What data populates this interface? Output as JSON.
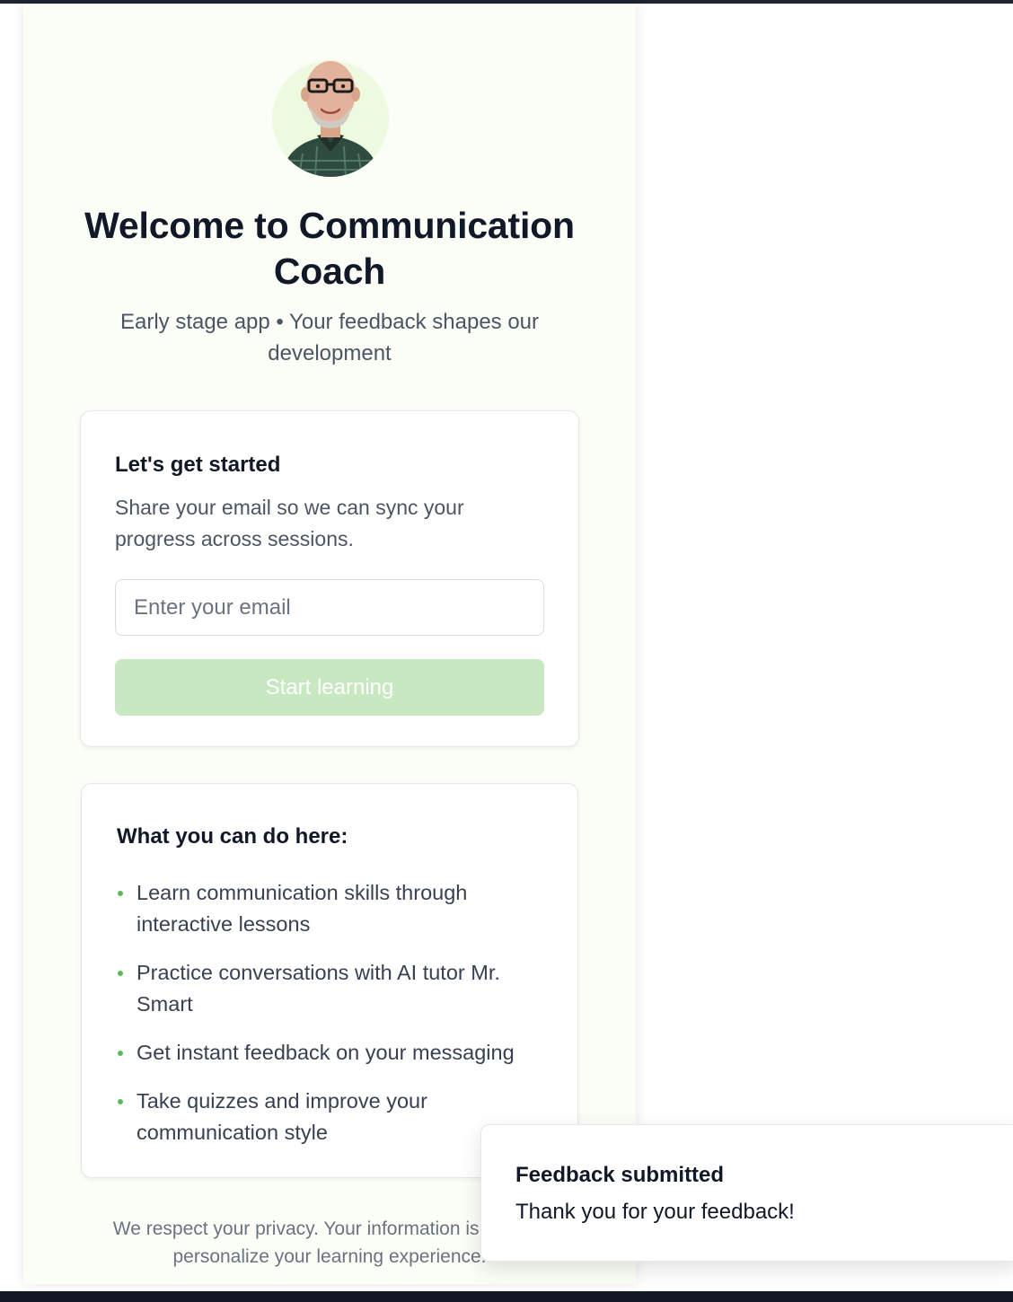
{
  "header": {
    "avatar_alt": "Mr. Smart avatar",
    "title": "Welcome to Communication Coach",
    "subtitle": "Early stage app • Your feedback shapes our development"
  },
  "signup_card": {
    "heading": "Let's get started",
    "description": "Share your email so we can sync your progress across sessions.",
    "email_placeholder": "Enter your email",
    "email_value": "",
    "start_button_label": "Start learning",
    "start_button_color": "#c7e8c0"
  },
  "features_card": {
    "heading": "What you can do here:",
    "items": [
      {
        "label": "Learn communication skills through interactive lessons"
      },
      {
        "label": "Practice conversations with AI tutor Mr. Smart"
      },
      {
        "label": "Get instant feedback on your messaging"
      },
      {
        "label": "Take quizzes and improve your communication style"
      }
    ],
    "bullet_color": "#5cb85c"
  },
  "privacy_note": "We respect your privacy. Your information is used to personalize your learning experience.",
  "toast": {
    "title": "Feedback submitted",
    "message": "Thank you for your feedback!"
  },
  "colors": {
    "panel_bg": "#fbfdf7",
    "avatar_bg": "#eefadf",
    "text_primary": "#111827",
    "text_secondary": "#4b5563"
  }
}
